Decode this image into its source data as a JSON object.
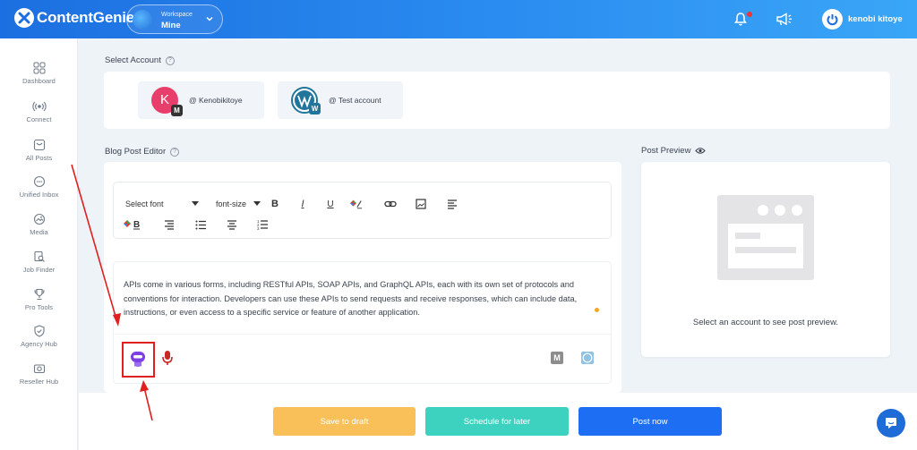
{
  "app": {
    "name": "ContentGenie"
  },
  "workspace": {
    "label": "Workspace",
    "value": "Mine"
  },
  "header": {
    "user_name": "kenobi kitoye"
  },
  "sidebar": {
    "items": [
      {
        "label": "Dashboard",
        "icon": "grid-icon"
      },
      {
        "label": "Connect",
        "icon": "broadcast-icon"
      },
      {
        "label": "All Posts",
        "icon": "inbox-icon"
      },
      {
        "label": "Unified Inbox",
        "icon": "chat-bubble-icon"
      },
      {
        "label": "Media",
        "icon": "media-icon"
      },
      {
        "label": "Job Finder",
        "icon": "search-doc-icon"
      },
      {
        "label": "Pro Tools",
        "icon": "trophy-icon"
      },
      {
        "label": "Agency Hub",
        "icon": "shield-check-icon"
      },
      {
        "label": "Reseller Hub",
        "icon": "camera-icon"
      }
    ]
  },
  "select_account": {
    "title": "Select Account",
    "accounts": [
      {
        "avatar_letter": "K",
        "badge": "M",
        "name": "@ Kenobikitoye",
        "color": "#e83e6c"
      },
      {
        "avatar_letter": "W",
        "badge": "W",
        "name": "@ Test account",
        "color": "#21759b"
      }
    ]
  },
  "editor": {
    "title": "Blog Post Editor",
    "toolbar": {
      "font_select": "Select font",
      "size_select": "font-size"
    },
    "content": "APIs come in various forms, including RESTful APIs, SOAP APIs, and GraphQL APIs, each with its own set of protocols and conventions for interaction. Developers can use these APIs to send requests and receive responses, which can include data, instructions, or even access to a specific service or feature of another application."
  },
  "preview": {
    "title": "Post Preview",
    "message": "Select an account to see post preview."
  },
  "actions": {
    "save_draft": "Save to draft",
    "schedule": "Schedule for later",
    "post_now": "Post now"
  },
  "colors": {
    "brand": "#1c6fe0",
    "save_draft": "#f9c05a",
    "schedule": "#3dd1bf",
    "post_now": "#1d6ef2",
    "annotation": "#e0201f"
  }
}
